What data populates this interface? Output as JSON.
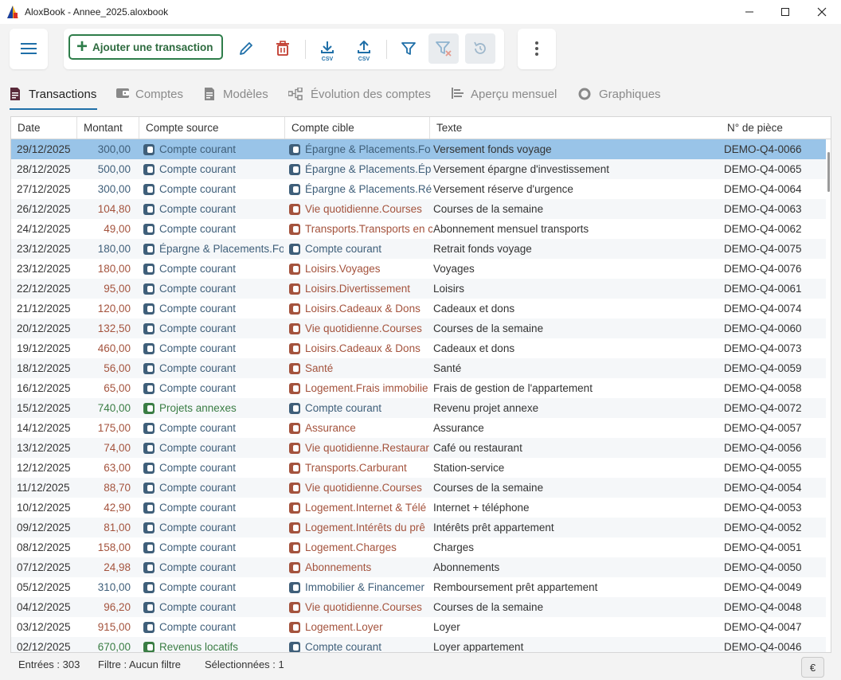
{
  "window": {
    "title": "AloxBook - Annee_2025.aloxbook"
  },
  "toolbar": {
    "add_label": "Ajouter une transaction",
    "csv_import_label": "CSV",
    "csv_export_label": "CSV"
  },
  "tabs": [
    {
      "label": "Transactions",
      "icon": "document-icon",
      "active": true
    },
    {
      "label": "Comptes",
      "icon": "wallet-icon"
    },
    {
      "label": "Modèles",
      "icon": "template-icon"
    },
    {
      "label": "Évolution des comptes",
      "icon": "network-icon"
    },
    {
      "label": "Aperçu mensuel",
      "icon": "list-icon"
    },
    {
      "label": "Graphiques",
      "icon": "chart-icon"
    }
  ],
  "grid": {
    "columns": [
      "Date",
      "Montant",
      "Compte source",
      "Compte cible",
      "Texte",
      "N° de pièce"
    ],
    "rows": [
      {
        "date": "29/12/2025",
        "amount": "300,00",
        "source": "Compte courant",
        "target": "Épargne & Placements.Fo",
        "text": "Versement fonds voyage",
        "ref": "DEMO-Q4-0066"
      },
      {
        "date": "28/12/2025",
        "amount": "500,00",
        "source": "Compte courant",
        "target": "Épargne & Placements.Ép",
        "text": "Versement épargne d'investissement",
        "ref": "DEMO-Q4-0065"
      },
      {
        "date": "27/12/2025",
        "amount": "300,00",
        "source": "Compte courant",
        "target": "Épargne & Placements.Ré",
        "text": "Versement réserve d'urgence",
        "ref": "DEMO-Q4-0064"
      },
      {
        "date": "26/12/2025",
        "amount": "104,80",
        "source": "Compte courant",
        "target": "Vie quotidienne.Courses",
        "text": "Courses de la semaine",
        "ref": "DEMO-Q4-0063"
      },
      {
        "date": "24/12/2025",
        "amount": "49,00",
        "source": "Compte courant",
        "target": "Transports.Transports en c",
        "text": "Abonnement mensuel transports",
        "ref": "DEMO-Q4-0062"
      },
      {
        "date": "23/12/2025",
        "amount": "180,00",
        "source": "Épargne & Placements.Fo",
        "target": "Compte courant",
        "text": "Retrait fonds voyage",
        "ref": "DEMO-Q4-0075"
      },
      {
        "date": "23/12/2025",
        "amount": "180,00",
        "source": "Compte courant",
        "target": "Loisirs.Voyages",
        "text": "Voyages",
        "ref": "DEMO-Q4-0076"
      },
      {
        "date": "22/12/2025",
        "amount": "95,00",
        "source": "Compte courant",
        "target": "Loisirs.Divertissement",
        "text": "Loisirs",
        "ref": "DEMO-Q4-0061"
      },
      {
        "date": "21/12/2025",
        "amount": "120,00",
        "source": "Compte courant",
        "target": "Loisirs.Cadeaux & Dons",
        "text": "Cadeaux et dons",
        "ref": "DEMO-Q4-0074"
      },
      {
        "date": "20/12/2025",
        "amount": "132,50",
        "source": "Compte courant",
        "target": "Vie quotidienne.Courses",
        "text": "Courses de la semaine",
        "ref": "DEMO-Q4-0060"
      },
      {
        "date": "19/12/2025",
        "amount": "460,00",
        "source": "Compte courant",
        "target": "Loisirs.Cadeaux & Dons",
        "text": "Cadeaux et dons",
        "ref": "DEMO-Q4-0073"
      },
      {
        "date": "18/12/2025",
        "amount": "56,00",
        "source": "Compte courant",
        "target": "Santé",
        "text": "Santé",
        "ref": "DEMO-Q4-0059"
      },
      {
        "date": "16/12/2025",
        "amount": "65,00",
        "source": "Compte courant",
        "target": "Logement.Frais immobilie",
        "text": "Frais de gestion de l'appartement",
        "ref": "DEMO-Q4-0058"
      },
      {
        "date": "15/12/2025",
        "amount": "740,00",
        "source": "Projets annexes",
        "target": "Compte courant",
        "text": "Revenu projet annexe",
        "ref": "DEMO-Q4-0072"
      },
      {
        "date": "14/12/2025",
        "amount": "175,00",
        "source": "Compte courant",
        "target": "Assurance",
        "text": "Assurance",
        "ref": "DEMO-Q4-0057"
      },
      {
        "date": "13/12/2025",
        "amount": "74,00",
        "source": "Compte courant",
        "target": "Vie quotidienne.Restaurar",
        "text": "Café ou restaurant",
        "ref": "DEMO-Q4-0056"
      },
      {
        "date": "12/12/2025",
        "amount": "63,00",
        "source": "Compte courant",
        "target": "Transports.Carburant",
        "text": "Station-service",
        "ref": "DEMO-Q4-0055"
      },
      {
        "date": "11/12/2025",
        "amount": "88,70",
        "source": "Compte courant",
        "target": "Vie quotidienne.Courses",
        "text": "Courses de la semaine",
        "ref": "DEMO-Q4-0054"
      },
      {
        "date": "10/12/2025",
        "amount": "42,90",
        "source": "Compte courant",
        "target": "Logement.Internet & Télé",
        "text": "Internet + téléphone",
        "ref": "DEMO-Q4-0053"
      },
      {
        "date": "09/12/2025",
        "amount": "81,00",
        "source": "Compte courant",
        "target": "Logement.Intérêts du prê",
        "text": "Intérêts prêt appartement",
        "ref": "DEMO-Q4-0052"
      },
      {
        "date": "08/12/2025",
        "amount": "158,00",
        "source": "Compte courant",
        "target": "Logement.Charges",
        "text": "Charges",
        "ref": "DEMO-Q4-0051"
      },
      {
        "date": "07/12/2025",
        "amount": "24,98",
        "source": "Compte courant",
        "target": "Abonnements",
        "text": "Abonnements",
        "ref": "DEMO-Q4-0050"
      },
      {
        "date": "05/12/2025",
        "amount": "310,00",
        "source": "Compte courant",
        "target": "Immobilier & Financemer",
        "text": "Remboursement prêt appartement",
        "ref": "DEMO-Q4-0049"
      },
      {
        "date": "04/12/2025",
        "amount": "96,20",
        "source": "Compte courant",
        "target": "Vie quotidienne.Courses",
        "text": "Courses de la semaine",
        "ref": "DEMO-Q4-0048"
      },
      {
        "date": "03/12/2025",
        "amount": "915,00",
        "source": "Compte courant",
        "target": "Logement.Loyer",
        "text": "Loyer",
        "ref": "DEMO-Q4-0047"
      },
      {
        "date": "02/12/2025",
        "amount": "670,00",
        "source": "Revenus locatifs",
        "target": "Compte courant",
        "text": "Loyer appartement",
        "ref": "DEMO-Q4-0046"
      }
    ]
  },
  "colors": {
    "asset": "#3f5f7a",
    "expense": "#a4533d",
    "income": "#3a7d44",
    "selected_row": "#99c4e8",
    "accent": "#1f6fa8",
    "delete": "#c0392b"
  },
  "status": {
    "entries": "Entrées : 303",
    "filter": "Filtre : Aucun filtre",
    "selected": "Sélectionnées : 1",
    "currency": "€"
  }
}
